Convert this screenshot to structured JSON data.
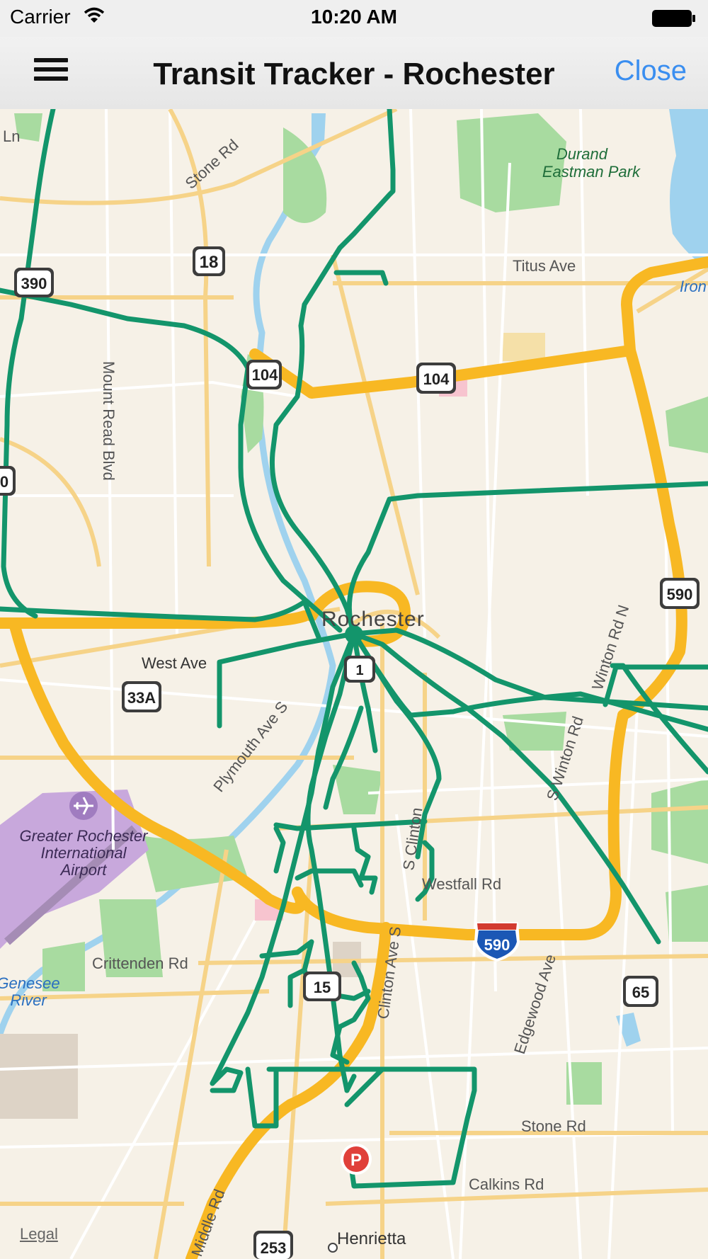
{
  "status_bar": {
    "carrier": "Carrier",
    "time": "10:20 AM",
    "wifi_icon": "wifi-icon",
    "battery_icon": "battery-icon"
  },
  "nav_bar": {
    "menu_icon": "hamburger-menu-icon",
    "title": "Transit Tracker - Rochester",
    "close_label": "Close",
    "accent_color": "#3a8ef0"
  },
  "map": {
    "route_color": "#13956b",
    "highway_color": "#f8b823",
    "water_color": "#9fd2ee",
    "park_color": "#a8dba0",
    "airport_color": "#c8a8dc",
    "place_labels": {
      "durand_1": "Durand",
      "durand_2": "Eastman Park",
      "titus": "Titus Ave",
      "stone_rd_north": "Stone Rd",
      "mount_read": "Mount Read Blvd",
      "rochester": "Rochester",
      "west_ave": "West Ave",
      "plymouth": "Plymouth Ave S",
      "winton_n": "Winton Rd N",
      "winton_s": "S Winton Rd",
      "clinton_s": "S Clinton",
      "clinton_ave_s": "Clinton Ave S",
      "westfall": "Westfall Rd",
      "crittenden": "Crittenden Rd",
      "edgewood": "Edgewood Ave",
      "stone_rd_south": "Stone Rd",
      "calkins": "Calkins Rd",
      "middle": "Middle Rd",
      "henrietta": "Henrietta",
      "ln": "Ln",
      "iron": "Iron",
      "airport_1": "Greater Rochester",
      "airport_2": "International",
      "airport_3": "Airport",
      "genesee_1": "Genesee",
      "genesee_2": "River"
    },
    "shields": {
      "s18": "18",
      "s104a": "104",
      "s104b": "104",
      "s390": "390",
      "s390b": "0",
      "s590a": "590",
      "s590b": "590",
      "s33a": "33A",
      "s65": "65",
      "s253": "253",
      "s15": "15",
      "s_center": "1"
    },
    "parking_marker": "P",
    "airport_icon": "airplane-icon",
    "legal_label": "Legal"
  }
}
